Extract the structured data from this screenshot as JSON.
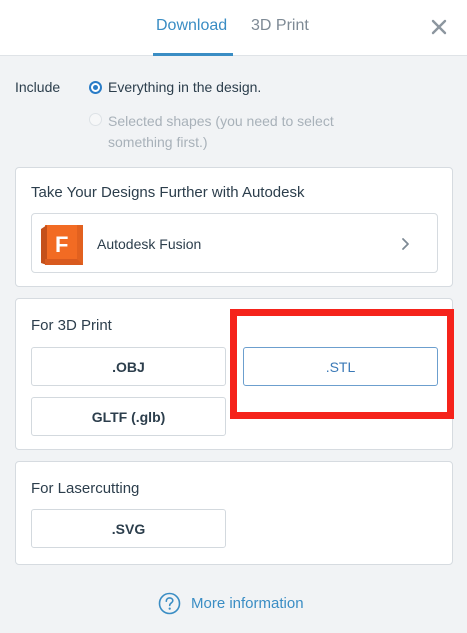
{
  "tabs": [
    {
      "label": "Download",
      "active": true
    },
    {
      "label": "3D Print",
      "active": false
    }
  ],
  "close_icon": "close-icon",
  "include": {
    "label": "Include",
    "options": [
      {
        "label": "Everything in the design.",
        "selected": true,
        "enabled": true
      },
      {
        "label": "Selected shapes (you need to select something first.)",
        "selected": false,
        "enabled": false
      }
    ]
  },
  "autodesk_card": {
    "title": "Take Your Designs Further with Autodesk",
    "item": {
      "letter": "F",
      "label": "Autodesk Fusion",
      "icon": "chevron-right-icon"
    }
  },
  "print_card": {
    "title": "For 3D Print",
    "buttons": [
      ".OBJ",
      ".STL",
      "GLTF (.glb)"
    ]
  },
  "laser_card": {
    "title": "For Lasercutting",
    "buttons": [
      ".SVG"
    ]
  },
  "more_info": {
    "label": "More information",
    "icon": "help-circle-icon"
  },
  "colors": {
    "accent": "#3a8dc4",
    "highlight": "#f5231b",
    "fusion_orange": "#f26b23"
  }
}
